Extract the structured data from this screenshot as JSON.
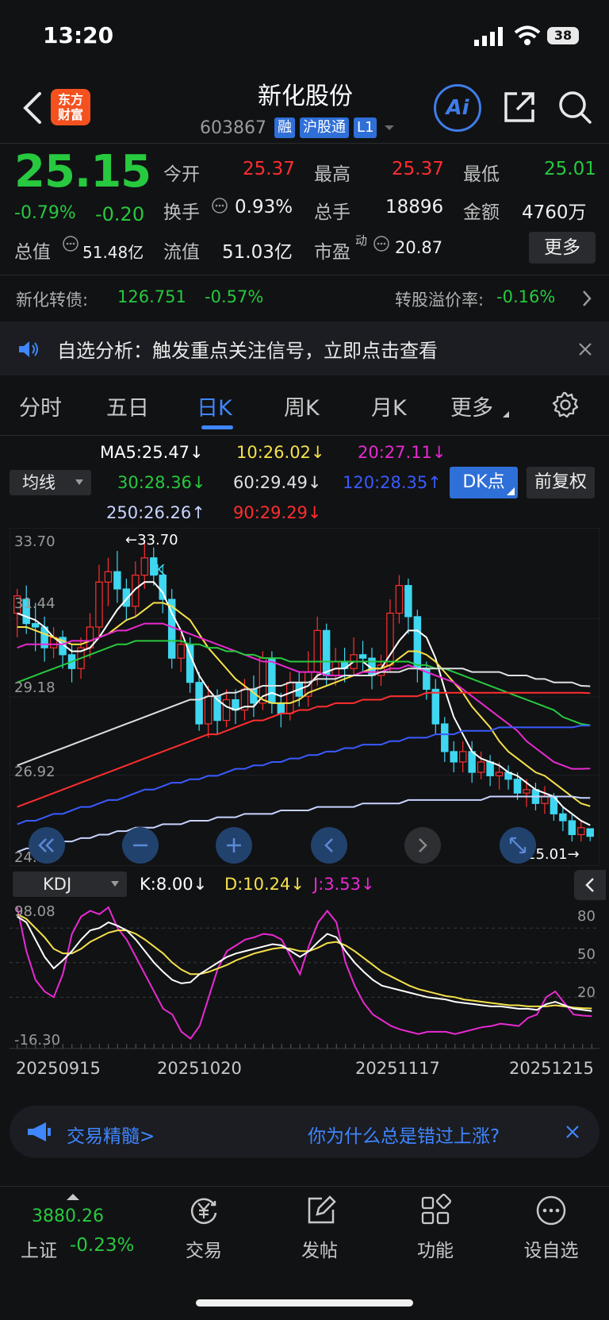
{
  "status_bar": {
    "time": "13:20",
    "battery": "38"
  },
  "header": {
    "logo_line1": "东方",
    "logo_line2": "财富",
    "stock_name": "新化股份",
    "stock_code": "603867",
    "tags": [
      "融",
      "沪股通",
      "L1"
    ],
    "ai_label": "Ai"
  },
  "quote": {
    "price": "25.15",
    "change_pct": "-0.79%",
    "change_abs": "-0.20",
    "open_label": "今开",
    "open": "25.37",
    "high_label": "最高",
    "high": "25.37",
    "low_label": "最低",
    "low": "25.01",
    "turnover_label": "换手",
    "turnover": "0.93%",
    "volume_label": "总手",
    "volume": "18896",
    "amount_label": "金额",
    "amount": "4760万",
    "mktcap_label": "总值",
    "mktcap": "51.48亿",
    "float_label": "流值",
    "float_cap": "51.03亿",
    "pe_label": "市盈",
    "pe_sup": "动",
    "pe": "20.87",
    "more_label": "更多"
  },
  "convertible": {
    "label": "新化转债:",
    "price": "126.751",
    "change": "-0.57%",
    "premium_label": "转股溢价率:",
    "premium": "-0.16%"
  },
  "notice": {
    "text": "自选分析：触发重点关注信号，立即点击查看"
  },
  "period_tabs": [
    "分时",
    "五日",
    "日K",
    "周K",
    "月K",
    "更多"
  ],
  "active_tab": "日K",
  "ma_legend": {
    "select_label": "均线",
    "ma5": "MA5:25.47↓",
    "ma10": "10:26.02↓",
    "ma20": "20:27.11↓",
    "ma30": "30:28.36↓",
    "ma60": "60:29.49↓",
    "ma120": "120:28.35↑",
    "ma250": "250:26.26↑",
    "ma90": "90:29.29↓",
    "dk_label": "DK点",
    "adjust_label": "前复权",
    "colors": {
      "ma5": "#ffffff",
      "ma10": "#f5e14a",
      "ma20": "#e82ad1",
      "ma30": "#27c93f",
      "ma60": "#e0e0e0",
      "ma120": "#3a5bff",
      "ma250": "#c8d4ff",
      "ma90": "#ff2e2e"
    }
  },
  "kline": {
    "y_labels": [
      "33.70",
      "31.44",
      "29.18",
      "26.92",
      "24.66"
    ],
    "high_marker": "←33.70",
    "low_marker": "25.01→",
    "k_marker": "K"
  },
  "kdj": {
    "select_label": "KDJ",
    "k": "K:8.00↓",
    "d": "D:10.24↓",
    "j": "J:3.53↓",
    "y_labels_left": [
      "98.08",
      "-16.30"
    ],
    "y_labels_right": [
      "80",
      "50",
      "20"
    ]
  },
  "dates": [
    "20250915",
    "20251020",
    "20251117",
    "20251215"
  ],
  "promo": {
    "left": "交易精髓>",
    "right": "你为什么总是错过上涨?"
  },
  "bottom_nav": {
    "index_value": "3880.26",
    "index_name": "上证",
    "index_change": "-0.23%",
    "items": [
      "交易",
      "发帖",
      "功能",
      "设自选"
    ]
  },
  "chart_data": {
    "type": "candlestick",
    "title": "",
    "ylim": [
      24.66,
      33.7
    ],
    "candles": [
      [
        31.6,
        32.1,
        30.9,
        32.3
      ],
      [
        32.0,
        31.3,
        31.0,
        32.4
      ],
      [
        31.3,
        31.2,
        30.5,
        31.9
      ],
      [
        31.2,
        30.6,
        30.2,
        31.5
      ],
      [
        30.6,
        30.9,
        30.3,
        31.2
      ],
      [
        30.9,
        30.4,
        30.0,
        31.1
      ],
      [
        30.4,
        30.0,
        29.6,
        30.7
      ],
      [
        30.0,
        30.6,
        29.7,
        30.9
      ],
      [
        30.6,
        31.2,
        30.3,
        31.6
      ],
      [
        31.2,
        32.5,
        30.9,
        33.0
      ],
      [
        32.5,
        32.8,
        31.8,
        33.2
      ],
      [
        32.8,
        32.3,
        31.9,
        33.4
      ],
      [
        32.3,
        31.8,
        31.4,
        32.6
      ],
      [
        31.8,
        32.7,
        31.5,
        33.1
      ],
      [
        32.7,
        33.2,
        32.3,
        33.7
      ],
      [
        33.2,
        32.7,
        32.4,
        33.5
      ],
      [
        32.7,
        32.0,
        31.6,
        33.0
      ],
      [
        32.0,
        30.3,
        30.0,
        32.3
      ],
      [
        30.3,
        30.7,
        29.9,
        31.0
      ],
      [
        30.7,
        29.6,
        29.3,
        30.9
      ],
      [
        29.6,
        28.4,
        28.2,
        29.9
      ],
      [
        28.4,
        29.2,
        28.0,
        29.5
      ],
      [
        29.2,
        28.5,
        28.1,
        29.4
      ],
      [
        28.5,
        29.1,
        28.3,
        29.4
      ],
      [
        29.1,
        28.8,
        28.4,
        29.4
      ],
      [
        28.8,
        29.4,
        28.5,
        29.7
      ],
      [
        29.4,
        29.0,
        28.6,
        29.8
      ],
      [
        29.0,
        30.3,
        28.8,
        30.5
      ],
      [
        30.3,
        29.0,
        28.7,
        30.5
      ],
      [
        29.0,
        28.7,
        28.3,
        29.3
      ],
      [
        28.7,
        29.6,
        28.5,
        29.9
      ],
      [
        29.6,
        29.2,
        28.9,
        29.9
      ],
      [
        29.2,
        29.9,
        28.9,
        30.5
      ],
      [
        29.9,
        31.1,
        29.5,
        31.5
      ],
      [
        31.1,
        29.8,
        29.5,
        31.3
      ],
      [
        29.8,
        30.2,
        29.5,
        30.6
      ],
      [
        30.2,
        30.0,
        29.6,
        30.6
      ],
      [
        30.0,
        30.4,
        29.8,
        30.9
      ],
      [
        30.4,
        30.3,
        29.9,
        30.8
      ],
      [
        30.3,
        29.8,
        29.4,
        30.6
      ],
      [
        29.8,
        30.1,
        29.5,
        30.4
      ],
      [
        30.1,
        31.6,
        29.9,
        32.0
      ],
      [
        31.6,
        32.4,
        31.3,
        32.7
      ],
      [
        32.4,
        31.5,
        31.0,
        32.6
      ],
      [
        31.5,
        30.0,
        29.6,
        31.7
      ],
      [
        30.0,
        29.4,
        29.1,
        30.2
      ],
      [
        29.4,
        28.4,
        28.1,
        29.7
      ],
      [
        28.4,
        27.6,
        27.3,
        28.6
      ],
      [
        27.6,
        27.3,
        27.0,
        27.9
      ],
      [
        27.3,
        27.6,
        27.0,
        27.9
      ],
      [
        27.6,
        27.0,
        26.7,
        27.9
      ],
      [
        27.0,
        27.3,
        26.8,
        27.6
      ],
      [
        27.3,
        26.9,
        26.6,
        27.5
      ],
      [
        26.9,
        27.0,
        26.5,
        27.3
      ],
      [
        27.0,
        26.8,
        26.5,
        27.2
      ],
      [
        26.8,
        26.4,
        26.2,
        27.0
      ],
      [
        26.4,
        26.5,
        26.0,
        26.8
      ],
      [
        26.5,
        26.1,
        25.9,
        26.7
      ],
      [
        26.1,
        26.3,
        25.8,
        26.6
      ],
      [
        26.3,
        25.8,
        25.6,
        26.4
      ],
      [
        25.8,
        25.6,
        25.3,
        26.0
      ],
      [
        25.6,
        25.2,
        25.0,
        25.8
      ],
      [
        25.2,
        25.4,
        25.0,
        25.6
      ],
      [
        25.37,
        25.15,
        25.01,
        25.37
      ]
    ],
    "series": [
      {
        "name": "MA5",
        "values": [
          31.6,
          31.5,
          31.4,
          31.2,
          30.9,
          30.7,
          30.5,
          30.5,
          30.6,
          30.9,
          31.3,
          31.7,
          32.0,
          32.3,
          32.5,
          32.5,
          32.2,
          31.6,
          31.1,
          30.4,
          29.8,
          29.4,
          29.1,
          28.9,
          28.8,
          28.9,
          28.9,
          29.2,
          29.3,
          29.2,
          29.3,
          29.4,
          29.5,
          29.8,
          29.9,
          30.0,
          30.0,
          30.2,
          30.2,
          30.0,
          30.0,
          30.4,
          30.8,
          31.1,
          31.1,
          30.9,
          30.3,
          29.4,
          28.6,
          28.1,
          27.6,
          27.4,
          27.3,
          27.2,
          27.0,
          26.9,
          26.7,
          26.5,
          26.4,
          26.3,
          26.0,
          25.8,
          25.6,
          25.47
        ]
      },
      {
        "name": "MA10",
        "values": [
          31.2,
          31.2,
          31.1,
          31.0,
          30.9,
          30.8,
          30.7,
          30.7,
          30.8,
          30.9,
          31.0,
          31.2,
          31.4,
          31.5,
          31.7,
          31.9,
          31.9,
          31.8,
          31.6,
          31.4,
          31.0,
          30.6,
          30.3,
          30.0,
          29.7,
          29.5,
          29.3,
          29.1,
          29.0,
          29.0,
          29.0,
          29.1,
          29.3,
          29.4,
          29.5,
          29.6,
          29.7,
          29.8,
          29.9,
          30.0,
          30.0,
          30.1,
          30.3,
          30.5,
          30.5,
          30.4,
          30.2,
          29.9,
          29.6,
          29.3,
          28.9,
          28.6,
          28.3,
          27.9,
          27.6,
          27.4,
          27.2,
          27.0,
          26.9,
          26.7,
          26.5,
          26.3,
          26.1,
          26.02
        ]
      },
      {
        "name": "MA20",
        "values": [
          30.6,
          30.7,
          30.7,
          30.7,
          30.7,
          30.7,
          30.8,
          30.8,
          30.8,
          30.9,
          31.0,
          31.1,
          31.1,
          31.2,
          31.3,
          31.3,
          31.3,
          31.2,
          31.1,
          31.0,
          30.9,
          30.8,
          30.7,
          30.6,
          30.5,
          30.4,
          30.3,
          30.2,
          30.2,
          30.1,
          30.0,
          29.9,
          29.9,
          29.9,
          29.8,
          29.8,
          29.8,
          29.8,
          29.9,
          29.9,
          29.9,
          30.0,
          30.0,
          30.1,
          30.0,
          29.9,
          29.8,
          29.7,
          29.6,
          29.4,
          29.2,
          29.0,
          28.8,
          28.6,
          28.4,
          28.2,
          27.9,
          27.7,
          27.5,
          27.3,
          27.2,
          27.1,
          27.1,
          27.11
        ]
      },
      {
        "name": "MA30",
        "values": [
          29.6,
          29.7,
          29.8,
          29.9,
          30.0,
          30.1,
          30.2,
          30.3,
          30.4,
          30.5,
          30.6,
          30.7,
          30.7,
          30.8,
          30.8,
          30.8,
          30.8,
          30.8,
          30.8,
          30.7,
          30.7,
          30.6,
          30.6,
          30.5,
          30.5,
          30.4,
          30.4,
          30.3,
          30.3,
          30.3,
          30.2,
          30.2,
          30.2,
          30.2,
          30.2,
          30.2,
          30.2,
          30.2,
          30.2,
          30.2,
          30.2,
          30.2,
          30.2,
          30.2,
          30.1,
          30.1,
          30.0,
          30.0,
          29.9,
          29.8,
          29.7,
          29.6,
          29.5,
          29.4,
          29.3,
          29.2,
          29.1,
          29.0,
          28.9,
          28.8,
          28.6,
          28.5,
          28.4,
          28.36
        ]
      },
      {
        "name": "MA60",
        "values": [
          27.2,
          27.3,
          27.4,
          27.5,
          27.6,
          27.7,
          27.8,
          27.9,
          28.0,
          28.1,
          28.2,
          28.3,
          28.4,
          28.5,
          28.6,
          28.7,
          28.8,
          28.9,
          29.0,
          29.1,
          29.1,
          29.2,
          29.2,
          29.3,
          29.3,
          29.4,
          29.4,
          29.5,
          29.5,
          29.5,
          29.6,
          29.6,
          29.6,
          29.7,
          29.7,
          29.7,
          29.8,
          29.8,
          29.8,
          29.8,
          29.9,
          29.9,
          29.9,
          30.0,
          30.0,
          30.0,
          30.0,
          30.0,
          30.0,
          30.0,
          29.9,
          29.9,
          29.9,
          29.9,
          29.8,
          29.8,
          29.8,
          29.7,
          29.7,
          29.6,
          29.6,
          29.6,
          29.5,
          29.49
        ]
      },
      {
        "name": "MA90",
        "values": [
          26.0,
          26.1,
          26.2,
          26.3,
          26.4,
          26.5,
          26.6,
          26.7,
          26.8,
          26.9,
          27.0,
          27.1,
          27.2,
          27.3,
          27.4,
          27.5,
          27.6,
          27.7,
          27.8,
          27.9,
          28.0,
          28.1,
          28.1,
          28.2,
          28.3,
          28.4,
          28.5,
          28.5,
          28.6,
          28.7,
          28.7,
          28.8,
          28.8,
          28.9,
          28.9,
          29.0,
          29.0,
          29.0,
          29.1,
          29.1,
          29.1,
          29.2,
          29.2,
          29.2,
          29.2,
          29.3,
          29.3,
          29.3,
          29.3,
          29.3,
          29.3,
          29.3,
          29.3,
          29.3,
          29.3,
          29.3,
          29.3,
          29.3,
          29.3,
          29.3,
          29.3,
          29.3,
          29.3,
          29.29
        ]
      },
      {
        "name": "MA120",
        "values": [
          25.5,
          25.6,
          25.6,
          25.7,
          25.8,
          25.8,
          25.9,
          26.0,
          26.0,
          26.1,
          26.2,
          26.2,
          26.3,
          26.4,
          26.5,
          26.5,
          26.6,
          26.7,
          26.7,
          26.8,
          26.8,
          26.9,
          26.9,
          27.0,
          27.1,
          27.1,
          27.2,
          27.2,
          27.3,
          27.3,
          27.4,
          27.4,
          27.5,
          27.5,
          27.6,
          27.6,
          27.7,
          27.7,
          27.8,
          27.8,
          27.8,
          27.9,
          27.9,
          28.0,
          28.0,
          28.0,
          28.1,
          28.1,
          28.1,
          28.2,
          28.2,
          28.2,
          28.2,
          28.3,
          28.3,
          28.3,
          28.3,
          28.3,
          28.3,
          28.3,
          28.3,
          28.3,
          28.35,
          28.35
        ]
      },
      {
        "name": "MA250",
        "values": [
          24.7,
          24.8,
          24.8,
          24.9,
          24.9,
          25.0,
          25.0,
          25.1,
          25.1,
          25.2,
          25.2,
          25.3,
          25.3,
          25.4,
          25.4,
          25.4,
          25.5,
          25.5,
          25.5,
          25.6,
          25.6,
          25.6,
          25.7,
          25.7,
          25.7,
          25.8,
          25.8,
          25.8,
          25.8,
          25.9,
          25.9,
          25.9,
          25.9,
          26.0,
          26.0,
          26.0,
          26.0,
          26.0,
          26.1,
          26.1,
          26.1,
          26.1,
          26.1,
          26.2,
          26.2,
          26.2,
          26.2,
          26.2,
          26.2,
          26.2,
          26.2,
          26.2,
          26.3,
          26.3,
          26.3,
          26.3,
          26.3,
          26.3,
          26.3,
          26.3,
          26.3,
          26.3,
          26.26,
          26.26
        ]
      }
    ],
    "kdj_series": {
      "K": [
        90,
        85,
        70,
        55,
        45,
        52,
        60,
        70,
        78,
        80,
        85,
        82,
        78,
        70,
        60,
        50,
        42,
        35,
        32,
        33,
        40,
        45,
        50,
        55,
        58,
        60,
        62,
        64,
        66,
        65,
        60,
        55,
        60,
        68,
        75,
        72,
        60,
        50,
        42,
        35,
        30,
        28,
        26,
        24,
        22,
        20,
        19,
        18,
        16,
        15,
        14,
        13,
        12,
        12,
        11,
        10,
        10,
        9,
        14,
        16,
        13,
        10,
        9,
        8
      ],
      "D": [
        92,
        88,
        80,
        72,
        62,
        58,
        58,
        62,
        68,
        72,
        76,
        78,
        78,
        75,
        70,
        64,
        58,
        50,
        44,
        40,
        40,
        42,
        45,
        48,
        52,
        55,
        58,
        60,
        62,
        63,
        62,
        60,
        60,
        63,
        67,
        68,
        65,
        60,
        54,
        48,
        42,
        38,
        34,
        30,
        27,
        25,
        23,
        21,
        20,
        18,
        17,
        16,
        15,
        14,
        13,
        13,
        12,
        12,
        12,
        13,
        12,
        11,
        10.5,
        10.24
      ],
      "J": [
        98,
        60,
        35,
        25,
        20,
        40,
        75,
        90,
        95,
        92,
        98,
        80,
        70,
        55,
        40,
        25,
        10,
        5,
        -10,
        -16,
        -5,
        20,
        45,
        60,
        65,
        70,
        72,
        75,
        74,
        70,
        55,
        40,
        65,
        85,
        95,
        85,
        50,
        30,
        15,
        5,
        0,
        -5,
        -8,
        -10,
        -12,
        -10,
        -10,
        -10,
        -12,
        -10,
        -8,
        -6,
        -5,
        -3,
        -4,
        -5,
        2,
        5,
        20,
        25,
        15,
        5,
        4,
        3.53
      ]
    }
  }
}
